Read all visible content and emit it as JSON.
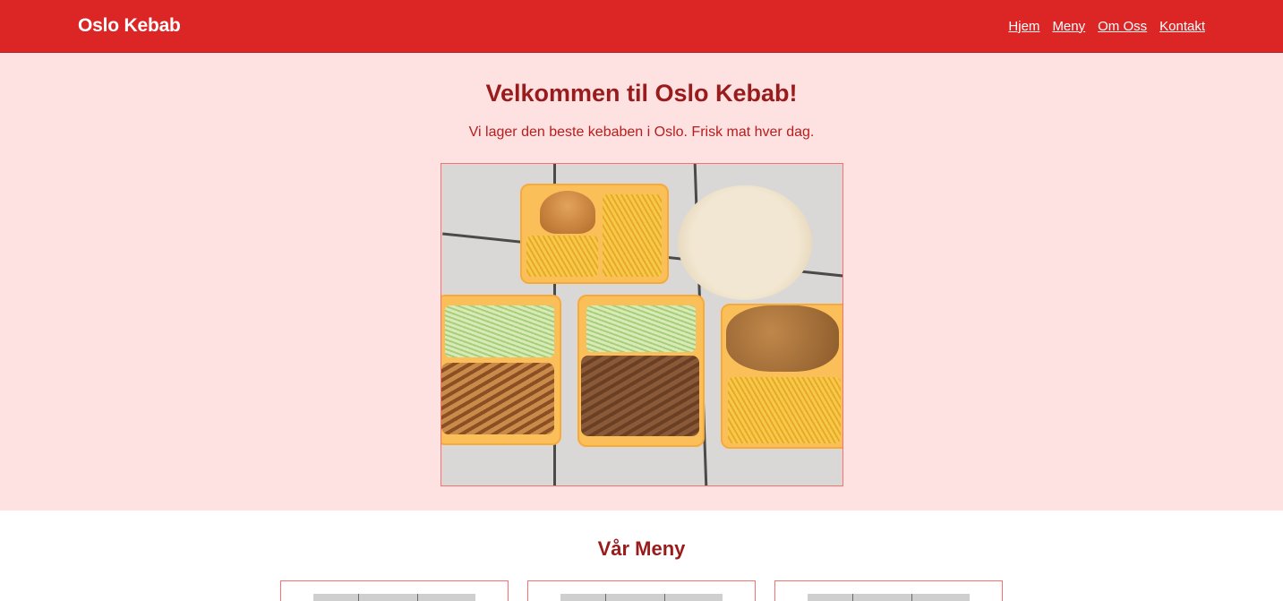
{
  "header": {
    "brand": "Oslo Kebab",
    "nav": [
      {
        "label": "Hjem"
      },
      {
        "label": "Meny"
      },
      {
        "label": "Om Oss"
      },
      {
        "label": "Kontakt"
      }
    ]
  },
  "hero": {
    "title": "Velkommen til Oslo Kebab!",
    "subtitle": "Vi lager den beste kebaben i Oslo. Frisk mat hver dag."
  },
  "menu": {
    "title": "Vår Meny"
  },
  "colors": {
    "header_bg": "#dc2626",
    "hero_bg": "#fee2e2",
    "heading": "#991b1b",
    "text_accent": "#b91c1c"
  }
}
